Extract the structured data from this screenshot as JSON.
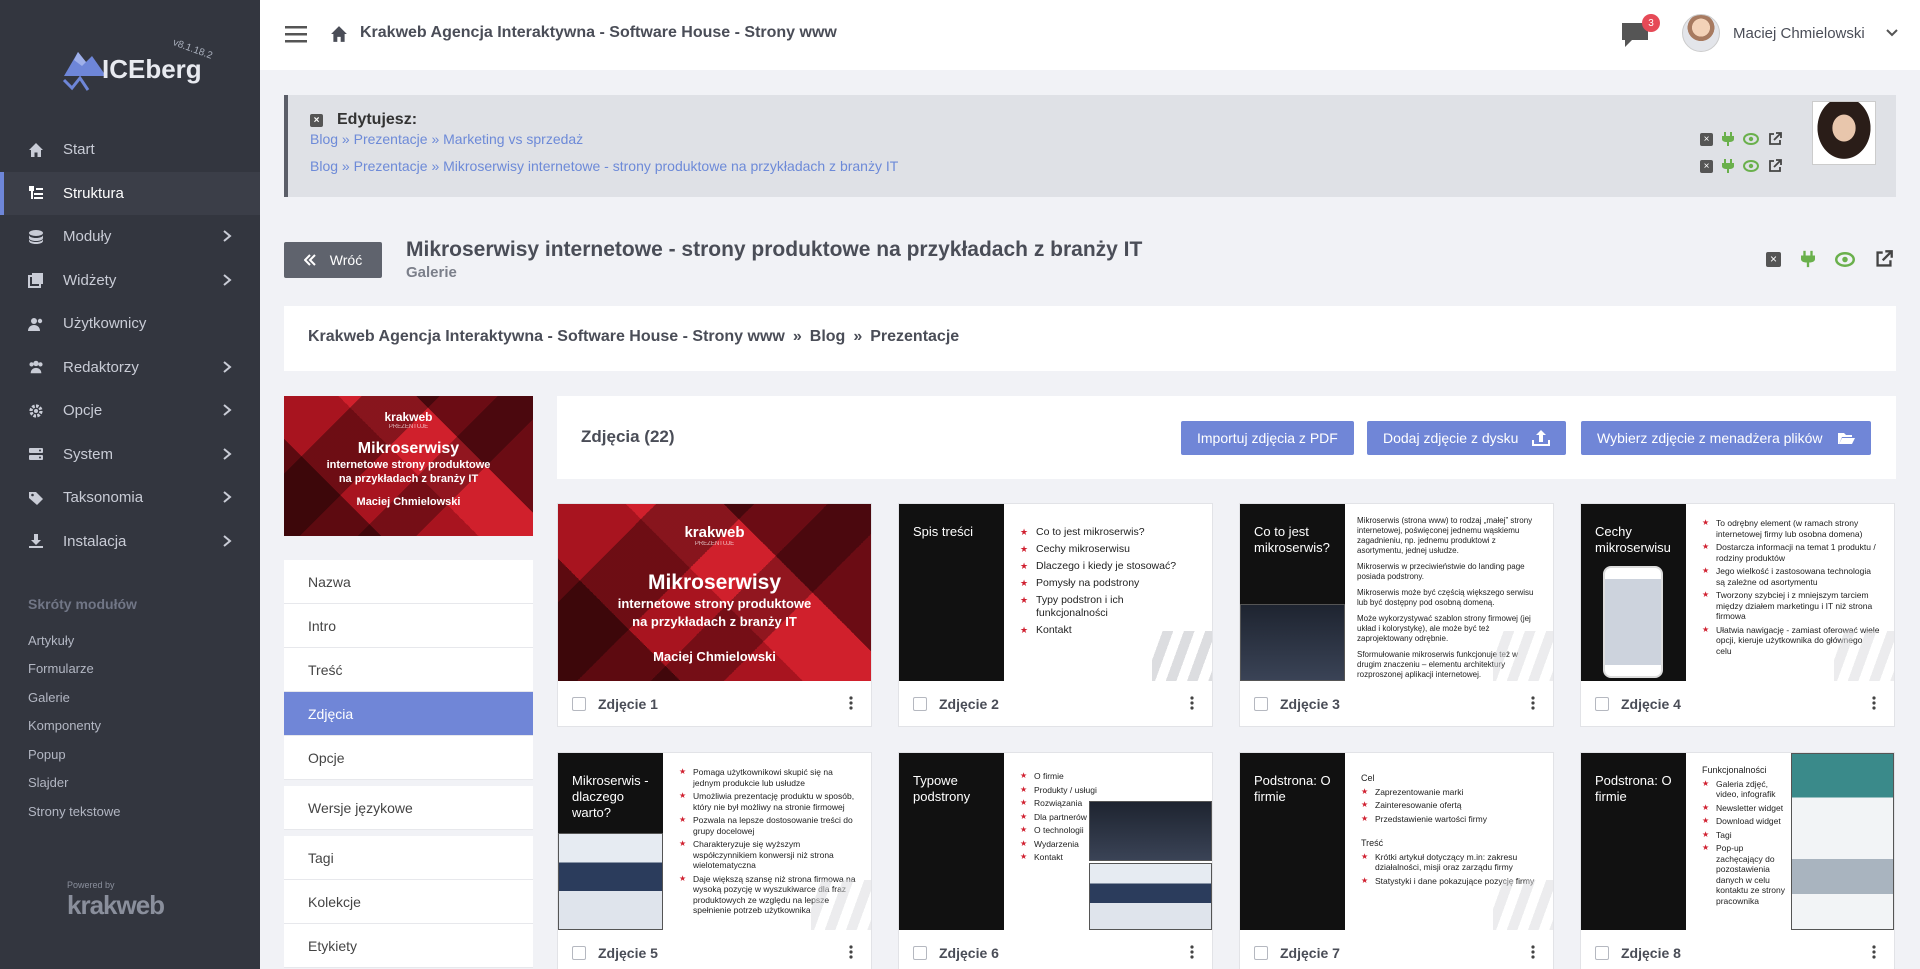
{
  "app": {
    "logo_text": "ICEberg",
    "version": "v8.1.18.2",
    "powered_label": "Powered by",
    "powered_brand": "krakweb"
  },
  "sidebar": {
    "items": [
      {
        "label": "Start",
        "icon": "home-icon"
      },
      {
        "label": "Struktura",
        "icon": "structure-icon",
        "active": true
      },
      {
        "label": "Moduły",
        "icon": "modules-icon",
        "chevron": true
      },
      {
        "label": "Widżety",
        "icon": "widgets-icon",
        "chevron": true
      },
      {
        "label": "Użytkownicy",
        "icon": "users-icon"
      },
      {
        "label": "Redaktorzy",
        "icon": "editors-icon",
        "chevron": true
      },
      {
        "label": "Opcje",
        "icon": "gear-icon",
        "chevron": true
      },
      {
        "label": "System",
        "icon": "server-icon",
        "chevron": true
      },
      {
        "label": "Taksonomia",
        "icon": "tags-icon",
        "chevron": true
      },
      {
        "label": "Instalacja",
        "icon": "download-icon",
        "chevron": true
      }
    ],
    "shortcuts_title": "Skróty modułów",
    "shortcuts": [
      "Artykuły",
      "Formularze",
      "Galerie",
      "Komponenty",
      "Popup",
      "Slajder",
      "Strony tekstowe"
    ]
  },
  "topbar": {
    "title": "Krakweb Agencja Interaktywna - Software House - Strony www",
    "notifications": "3",
    "user_name": "Maciej Chmielowski"
  },
  "editing": {
    "title": "Edytujesz:",
    "rows": [
      [
        "Blog",
        "Prezentacje",
        "Marketing vs sprzedaż"
      ],
      [
        "Blog",
        "Prezentacje",
        "Mikroserwisy internetowe - strony produktowe na przykładach z branży IT"
      ]
    ],
    "separator": "»"
  },
  "page": {
    "back_label": "Wróć",
    "title": "Mikroserwisy internetowe - strony produktowe na przykładach z branży IT",
    "subtitle": "Galerie"
  },
  "breadcrumb": {
    "items": [
      "Krakweb Agencja Interaktywna - Software House - Strony www",
      "Blog",
      "Prezentacje"
    ],
    "separator": "»"
  },
  "tabs": {
    "group1": [
      {
        "label": "Nazwa"
      },
      {
        "label": "Intro"
      },
      {
        "label": "Treść"
      },
      {
        "label": "Zdjęcia",
        "active": true
      },
      {
        "label": "Opcje"
      }
    ],
    "group2": [
      {
        "label": "Wersje językowe"
      }
    ],
    "group3": [
      {
        "label": "Tagi"
      },
      {
        "label": "Kolekcje"
      },
      {
        "label": "Etykiety"
      }
    ]
  },
  "gallery": {
    "title": "Zdjęcia (22)",
    "buttons": {
      "import_pdf": "Importuj zdjęcia z PDF",
      "add_disk": "Dodaj zdjęcie z dysku",
      "file_manager": "Wybierz zdjęcie z menadżera plików"
    },
    "photos": [
      {
        "label": "Zdjęcie 1"
      },
      {
        "label": "Zdjęcie 2"
      },
      {
        "label": "Zdjęcie 3"
      },
      {
        "label": "Zdjęcie 4"
      },
      {
        "label": "Zdjęcie 5"
      },
      {
        "label": "Zdjęcie 6"
      },
      {
        "label": "Zdjęcie 7"
      },
      {
        "label": "Zdjęcie 8"
      }
    ]
  },
  "slides": {
    "cover": {
      "brand": "krakweb",
      "tag": "PREZENTUJE",
      "title": "Mikroserwisy",
      "line1": "internetowe strony produktowe",
      "line2": "na przykładach z branży IT",
      "author": "Maciej  Chmielowski"
    },
    "s2": {
      "heading": "Spis treści",
      "items": [
        "Co to jest mikroserwis?",
        "Cechy mikroserwisu",
        "Dlaczego i kiedy je stosować?",
        "Pomysły na podstrony",
        "Typy podstron i ich funkcjonalności",
        "Kontakt"
      ]
    },
    "s3": {
      "heading": "Co to jest mikroserwis?",
      "p1": "Mikroserwis (strona www) to rodzaj „małej” strony internetowej, poświęconej jednemu wąskiemu zagadnieniu, np. jednemu produktowi z asortymentu, jednej usłudze.",
      "p2": "Mikroserwis w przeciwieństwie do landing page posiada podstrony.",
      "p3": "Mikroserwis może być częścią większego serwisu lub być dostępny pod osobną domeną.",
      "p4": "Może wykorzystywać szablon strony firmowej (jej układ i kolorystykę), ale może być też zaprojektowany odrębnie.",
      "p5": "Sformułowanie mikroserwis funkcjonuje też w drugim znaczeniu – elementu architektury rozproszonej aplikacji internetowej."
    },
    "s4": {
      "heading": "Cechy mikroserwisu",
      "items": [
        "To odrębny element (w ramach strony internetowej firmy lub osobna domena)",
        "Dostarcza informacji na temat 1 produktu / rodziny produktów",
        "Jego wielkość i zastosowana technologia są zależne od asortymentu",
        "Tworzony szybciej i z mniejszym tarciem między działem marketingu i IT niż strona firmowa",
        "Ułatwia nawigację - zamiast oferować wiele opcji, kieruje użytkownika do głównego celu"
      ]
    },
    "s5": {
      "heading": "Mikroserwis - dlaczego warto?",
      "items": [
        "Pomaga użytkownikowi skupić się na jednym produkcie lub usłudze",
        "Umożliwia prezentację produktu w sposób, który nie był możliwy na stronie firmowej",
        "Pozwala na lepsze dostosowanie treści do grupy docelowej",
        "Charakteryzuje się wyższym współczynnikiem konwersji niż strona wielotematyczna",
        "Daje większą szansę niż strona firmowa na wysoką pozycję w wyszukiwarce dla fraz produktowych ze względu na lepsze spełnienie potrzeb użytkownika"
      ]
    },
    "s6": {
      "heading": "Typowe podstrony",
      "items": [
        "O firmie",
        "Produkty / usługi",
        "Rozwiązania",
        "Dla partnerów",
        "O technologii",
        "Wydarzenia",
        "Kontakt"
      ]
    },
    "s7": {
      "heading": "Podstrona: O firmie",
      "cel_label": "Cel",
      "cel_items": [
        "Zaprezentowanie marki",
        "Zainteresowanie ofertą",
        "Przedstawienie wartości firmy"
      ],
      "tresc_label": "Treść",
      "tresc_items": [
        "Krótki artykuł dotyczący m.in: zakresu działalności, misji oraz zarządu firmy",
        "Statystyki i dane pokazujące pozycję firmy"
      ]
    },
    "s8": {
      "heading": "Podstrona: O firmie",
      "label": "Funkcjonalności",
      "items": [
        "Galeria zdjęć, video, infografik",
        "Newsletter widget",
        "Download widget",
        "Tagi",
        "Pop-up zachęcający do pozostawienia danych w celu kontaktu ze strony pracownika"
      ]
    }
  },
  "colors": {
    "sidebar_bg": "#33363f",
    "accent": "#7086d7",
    "link": "#6d8ad8",
    "badge": "#e64a57",
    "green_icon": "#6ab04c"
  }
}
